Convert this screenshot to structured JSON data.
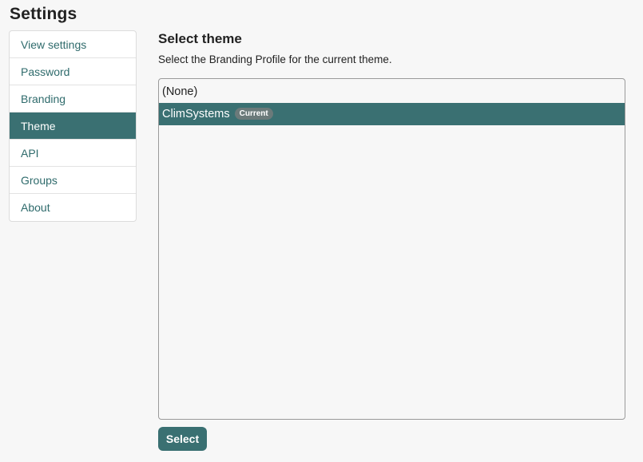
{
  "page": {
    "title": "Settings"
  },
  "sidebar": {
    "items": [
      {
        "label": "View settings",
        "active": false
      },
      {
        "label": "Password",
        "active": false
      },
      {
        "label": "Branding",
        "active": false
      },
      {
        "label": "Theme",
        "active": true
      },
      {
        "label": "API",
        "active": false
      },
      {
        "label": "Groups",
        "active": false
      },
      {
        "label": "About",
        "active": false
      }
    ]
  },
  "main": {
    "title": "Select theme",
    "description": "Select the Branding Profile for the current theme.",
    "options": [
      {
        "label": "(None)",
        "selected": false,
        "badge": ""
      },
      {
        "label": "ClimSystems",
        "selected": true,
        "badge": "Current"
      }
    ],
    "select_label": "Select"
  },
  "colors": {
    "accent": "#3a7072",
    "link": "#2f6b6c",
    "badge": "#6b7a7a",
    "background": "#f7f7f7"
  }
}
